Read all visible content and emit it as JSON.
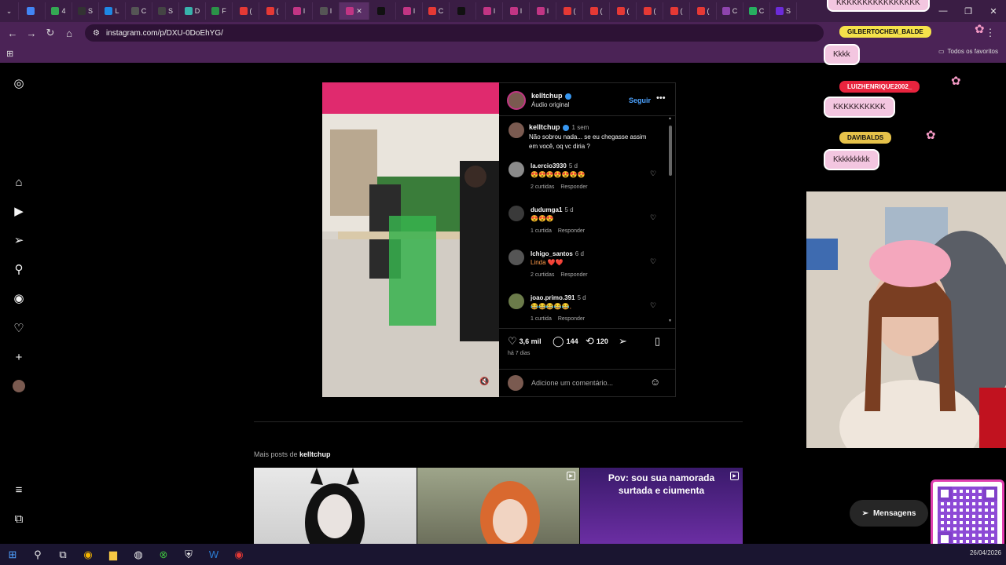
{
  "browser": {
    "tabs": [
      {
        "letter": "",
        "color": "#4285f4"
      },
      {
        "letter": "4",
        "color": "#34a853"
      },
      {
        "letter": "S",
        "color": "#333333"
      },
      {
        "letter": "L",
        "color": "#1e88e5"
      },
      {
        "letter": "C",
        "color": "#555555"
      },
      {
        "letter": "S",
        "color": "#444444"
      },
      {
        "letter": "D",
        "color": "#38b2ac"
      },
      {
        "letter": "F",
        "color": "#2b9348"
      },
      {
        "letter": "(",
        "color": "#e53935"
      },
      {
        "letter": "(",
        "color": "#e53935"
      },
      {
        "letter": "I",
        "color": "#c13584"
      },
      {
        "letter": "I",
        "color": "#555555"
      }
    ],
    "active_tab_letter": "I",
    "tabs_after": [
      {
        "letter": "",
        "color": "#111111"
      },
      {
        "letter": "I",
        "color": "#c13584"
      },
      {
        "letter": "C",
        "color": "#e53935"
      },
      {
        "letter": "",
        "color": "#111111"
      },
      {
        "letter": "I",
        "color": "#c13584"
      },
      {
        "letter": "I",
        "color": "#c13584"
      },
      {
        "letter": "I",
        "color": "#c13584"
      },
      {
        "letter": "(",
        "color": "#e53935"
      },
      {
        "letter": "(",
        "color": "#e53935"
      },
      {
        "letter": "(",
        "color": "#e53935"
      },
      {
        "letter": "(",
        "color": "#e53935"
      },
      {
        "letter": "(",
        "color": "#e53935"
      },
      {
        "letter": "(",
        "color": "#e53935"
      },
      {
        "letter": "C",
        "color": "#8e44ad"
      },
      {
        "letter": "C",
        "color": "#27ae60"
      },
      {
        "letter": "S",
        "color": "#6c2bd9"
      }
    ],
    "url": "instagram.com/p/DXU-0DoEhYG/",
    "all_favorites": "Todos os favoritos"
  },
  "post": {
    "author": "kelltchup",
    "audio": "Áudio original",
    "follow": "Seguir",
    "caption_user": "kelltchup",
    "caption_time": "1 sem",
    "caption_text": "Não sobrou nada... se eu chegasse assim em você, oq vc diria ?",
    "comments": [
      {
        "user": "la.ercio3930",
        "time": "5 d",
        "text": "😍😍😍😍😍😍😍",
        "replies": "2 curtidas",
        "reply": "Responder"
      },
      {
        "user": "dudumga1",
        "time": "5 d",
        "text": "😍😍😍",
        "replies": "1 curtida",
        "reply": "Responder"
      },
      {
        "user": "lchigo_santos",
        "time": "6 d",
        "text": "Linda ❤️❤️",
        "replies": "2 curtidas",
        "reply": "Responder"
      },
      {
        "user": "joao.primo.391",
        "time": "5 d",
        "text": "😂😂😂😂😂,",
        "replies": "1 curtida",
        "reply": "Responder"
      }
    ],
    "likes": "3,6 mil",
    "comments_count": "144",
    "reposts": "120",
    "ago": "há 7 dias",
    "add_comment": "Adicione um comentário..."
  },
  "more_posts": {
    "prefix": "Mais posts de",
    "user": "kelltchup",
    "thumb3_text": "Pov: sou sua namorada surtada e ciumenta"
  },
  "messages": "Mensagens",
  "stream": {
    "top_bubble": "KKKKKKKKKKKKKKKK",
    "names": [
      "GILBERTOCHEM_BALDE",
      "LUIZHENRIQUE2002_",
      "DAVIBALDS"
    ],
    "bubbles": [
      "Kkkk",
      "KKKKKKKKKK",
      "Kkkkkkkkk"
    ]
  },
  "taskbar": {
    "date": "26/04/2026"
  },
  "colors": {
    "accent": "#4da3ff",
    "overlay_pink": "#f3c6e0",
    "browser_purple": "#4b2356"
  }
}
